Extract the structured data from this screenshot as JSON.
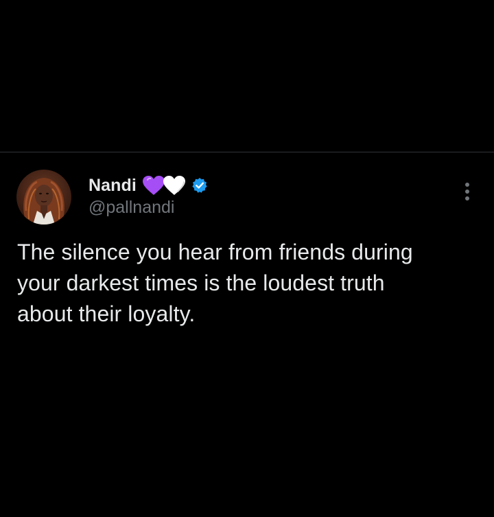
{
  "colors": {
    "background": "#000000",
    "primary_text": "#e7e9ea",
    "secondary_text": "#71767b",
    "divider": "#2f3336",
    "verified_badge": "#1d9bf0",
    "purple_heart": "#a64ef5",
    "white_heart": "#ffffff"
  },
  "tweet": {
    "author": {
      "display_name": "Nandi",
      "name_emojis": [
        "purple-heart-icon",
        "white-heart-icon"
      ],
      "verified": true,
      "handle": "@pallnandi",
      "avatar_icon": "profile-photo"
    },
    "menu_icon": "more-vertical-icon",
    "text_lines": [
      "The silence you hear from friends during",
      "your darkest times is the loudest truth",
      "about their loyalty."
    ]
  }
}
